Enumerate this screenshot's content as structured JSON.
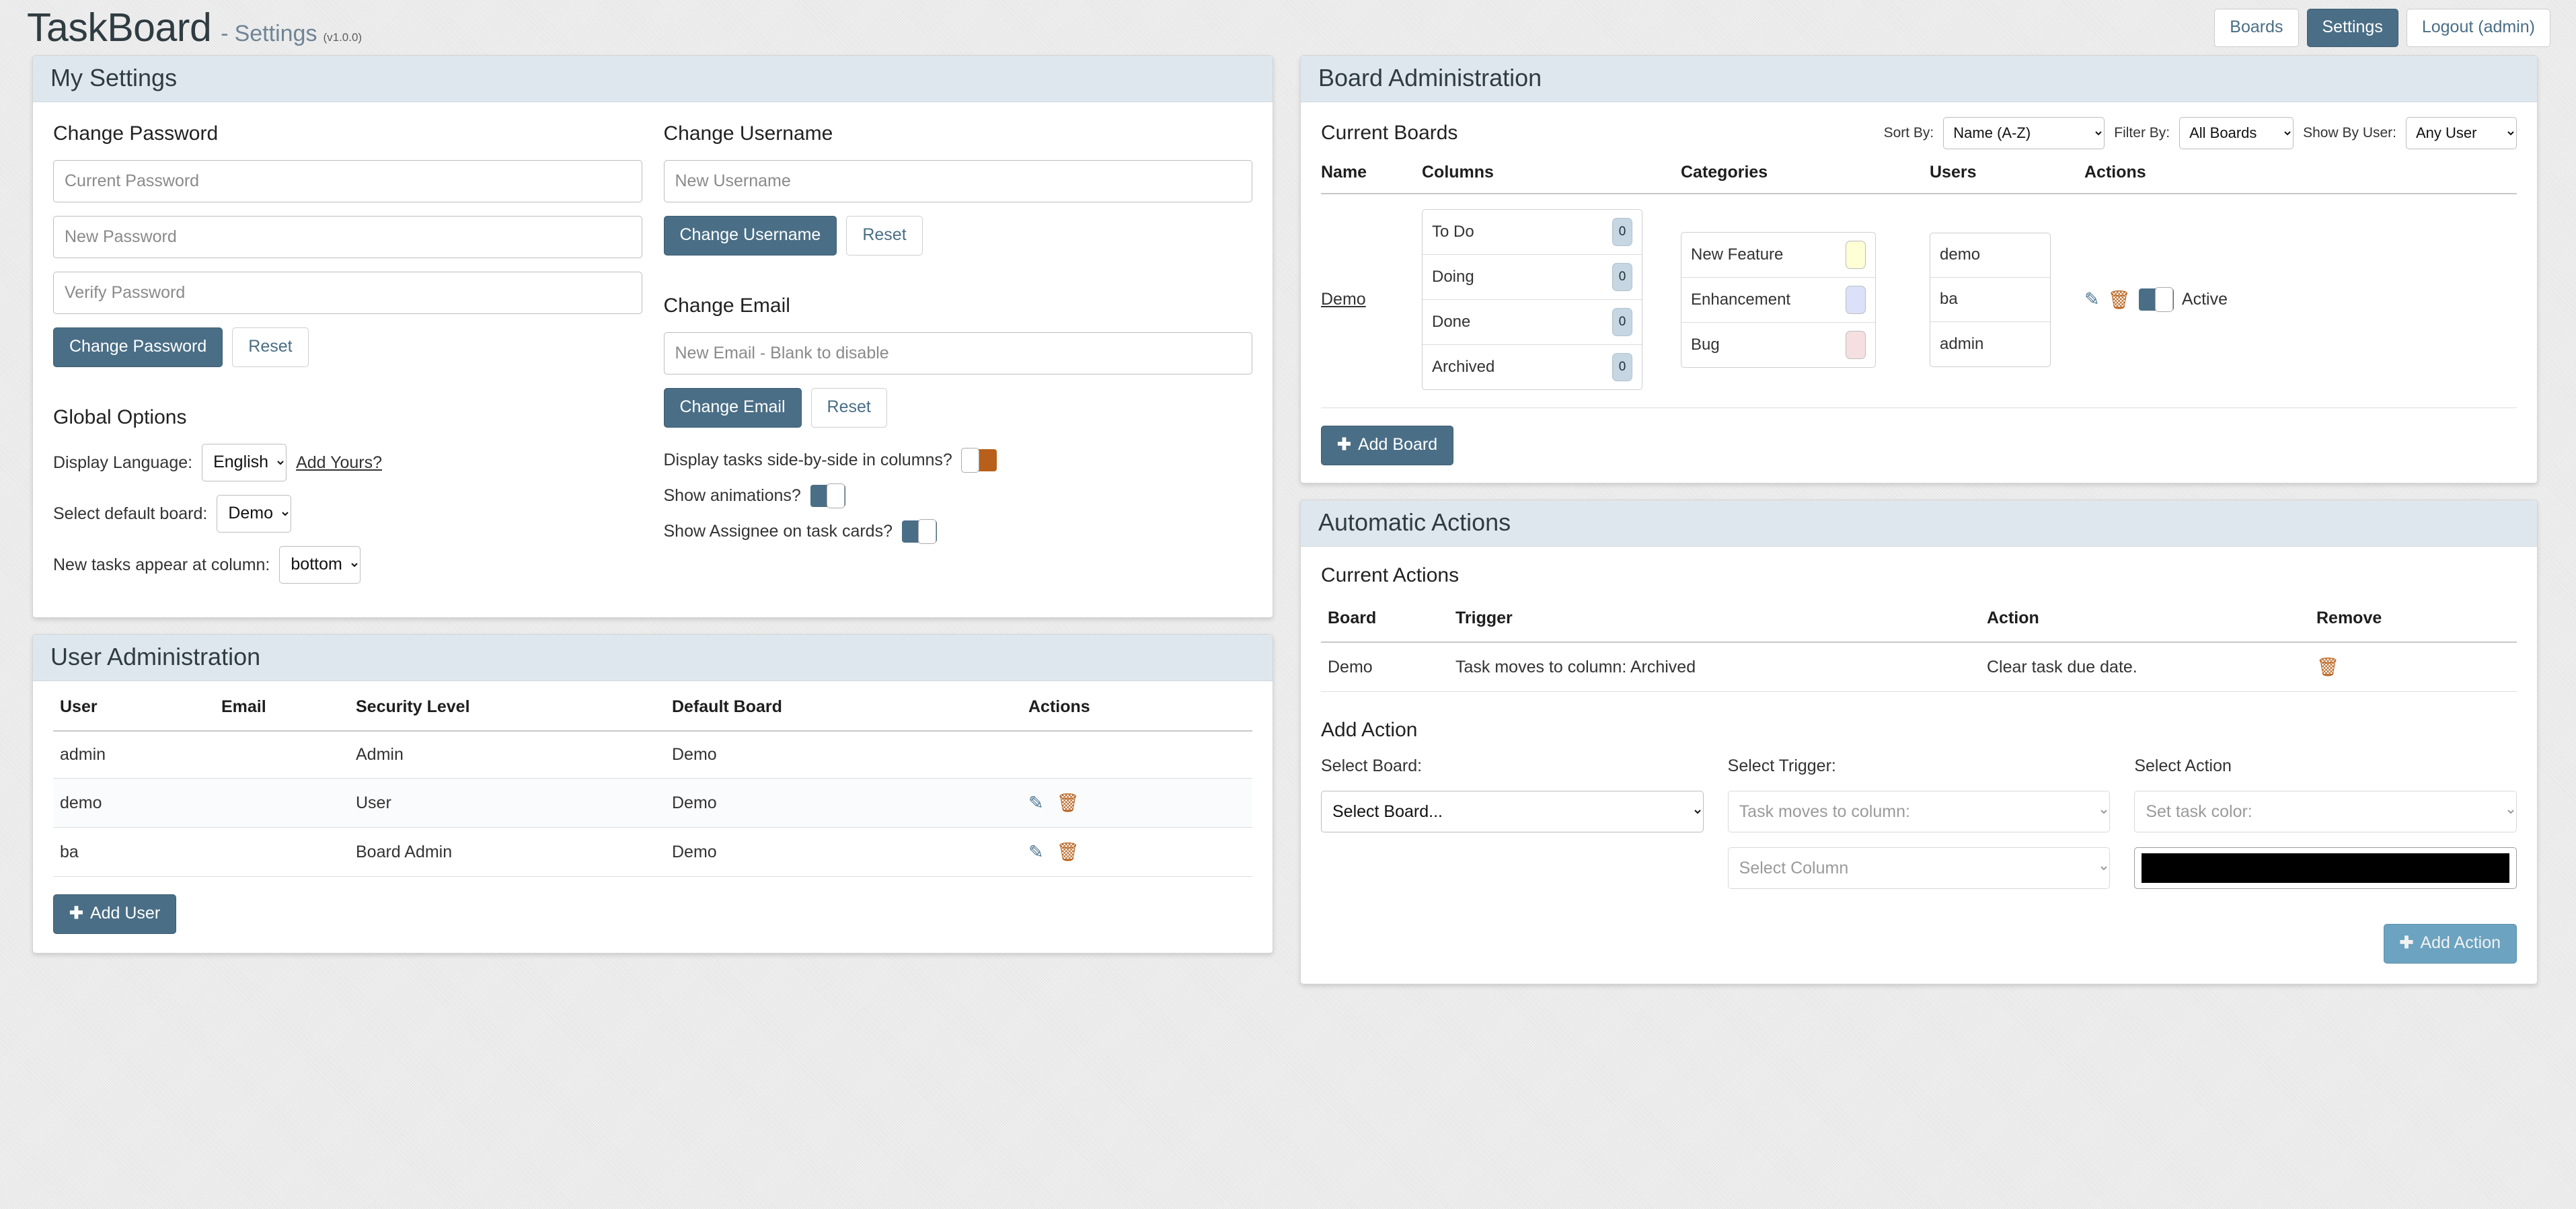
{
  "header": {
    "brand": "TaskBoard",
    "separator": "-",
    "page": "Settings",
    "version": "(v1.0.0)",
    "nav": [
      {
        "label": "Boards",
        "active": false
      },
      {
        "label": "Settings",
        "active": true
      },
      {
        "label": "Logout (admin)",
        "active": false
      }
    ]
  },
  "my_settings": {
    "title": "My Settings",
    "change_password": {
      "heading": "Change Password",
      "current_placeholder": "Current Password",
      "new_placeholder": "New Password",
      "verify_placeholder": "Verify Password",
      "submit_label": "Change Password",
      "reset_label": "Reset"
    },
    "change_username": {
      "heading": "Change Username",
      "placeholder": "New Username",
      "submit_label": "Change Username",
      "reset_label": "Reset"
    },
    "change_email": {
      "heading": "Change Email",
      "placeholder": "New Email - Blank to disable",
      "submit_label": "Change Email",
      "reset_label": "Reset"
    },
    "global_options": {
      "heading": "Global Options",
      "display_language_label": "Display Language:",
      "display_language_value": "English",
      "add_yours_label": "Add Yours?",
      "default_board_label": "Select default board:",
      "default_board_value": "Demo",
      "new_tasks_label": "New tasks appear at column:",
      "new_tasks_value": "bottom"
    },
    "toggles": [
      {
        "label": "Display tasks side-by-side in columns?",
        "state": "off"
      },
      {
        "label": "Show animations?",
        "state": "on"
      },
      {
        "label": "Show Assignee on task cards?",
        "state": "on"
      }
    ]
  },
  "user_admin": {
    "title": "User Administration",
    "columns": [
      "User",
      "Email",
      "Security Level",
      "Default Board",
      "Actions"
    ],
    "rows": [
      {
        "user": "admin",
        "email": "",
        "security": "Admin",
        "board": "Demo",
        "actions": []
      },
      {
        "user": "demo",
        "email": "",
        "security": "User",
        "board": "Demo",
        "actions": [
          "edit",
          "delete"
        ]
      },
      {
        "user": "ba",
        "email": "",
        "security": "Board Admin",
        "board": "Demo",
        "actions": [
          "edit",
          "delete"
        ]
      }
    ],
    "add_user_label": "Add User",
    "plus": "✚"
  },
  "board_admin": {
    "title": "Board Administration",
    "current_boards_label": "Current Boards",
    "sort_by_label": "Sort By:",
    "sort_by_value": "Name (A-Z)",
    "filter_by_label": "Filter By:",
    "filter_by_value": "All Boards",
    "show_by_user_label": "Show By User:",
    "show_by_user_value": "Any User",
    "columns": [
      "Name",
      "Columns",
      "Categories",
      "Users",
      "Actions"
    ],
    "board": {
      "name": "Demo",
      "columns": [
        {
          "name": "To Do",
          "count": "0"
        },
        {
          "name": "Doing",
          "count": "0"
        },
        {
          "name": "Done",
          "count": "0"
        },
        {
          "name": "Archived",
          "count": "0"
        }
      ],
      "categories": [
        {
          "name": "New Feature",
          "color": "#ffffd6"
        },
        {
          "name": "Enhancement",
          "color": "#dbe1f8"
        },
        {
          "name": "Bug",
          "color": "#f6dfe1"
        }
      ],
      "users": [
        "demo",
        "ba",
        "admin"
      ],
      "active_label": "Active",
      "active_state": "on"
    },
    "add_board_label": "Add Board",
    "plus": "✚"
  },
  "auto_actions": {
    "title": "Automatic Actions",
    "current_actions_label": "Current Actions",
    "columns": [
      "Board",
      "Trigger",
      "Action",
      "Remove"
    ],
    "rows": [
      {
        "board": "Demo",
        "trigger": "Task moves to column: Archived",
        "action": "Clear task due date."
      }
    ],
    "add_action_label": "Add Action",
    "select_board_label": "Select Board:",
    "select_board_value": "Select Board...",
    "select_trigger_label": "Select Trigger:",
    "select_trigger_value": "Task moves to column:",
    "select_column_value": "Select Column",
    "select_action_label": "Select Action",
    "select_action_value": "Set task color:",
    "action_color": "#000000",
    "add_button_label": "Add Action",
    "plus": "✚"
  },
  "icons": {
    "edit": "✎",
    "trash": "🗑",
    "chevron": "⌄"
  }
}
